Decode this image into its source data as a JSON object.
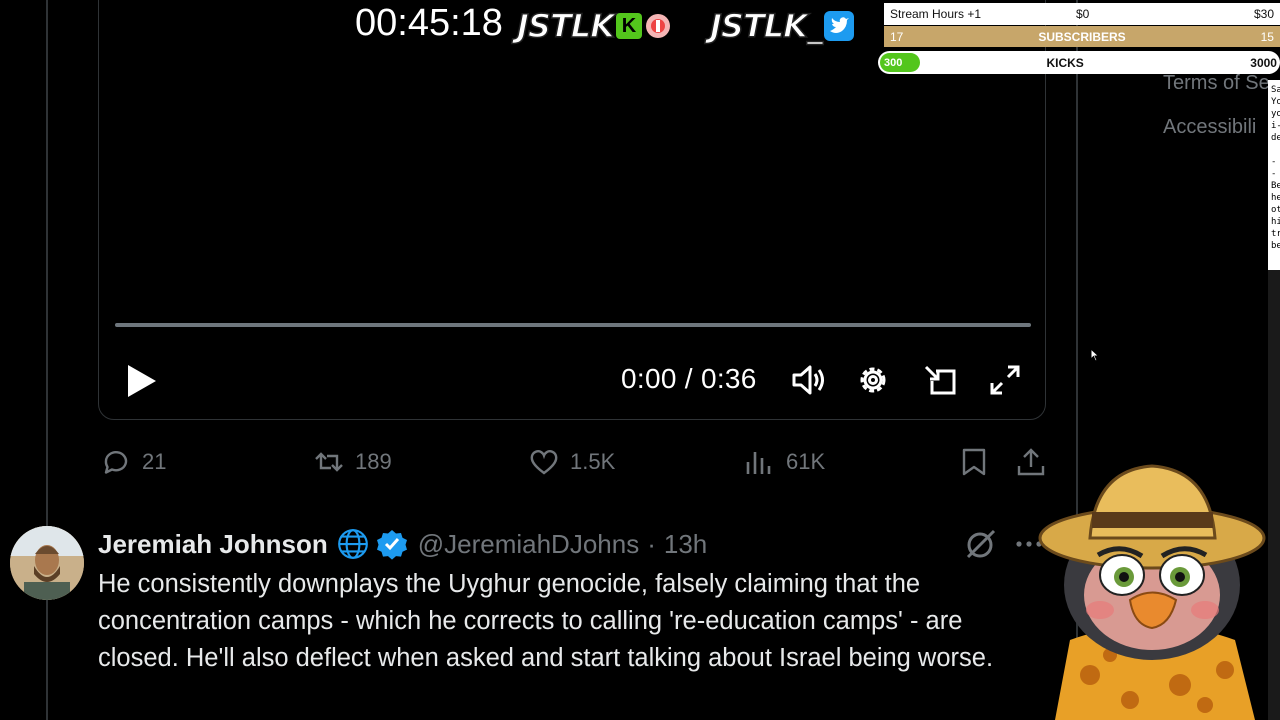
{
  "video": {
    "current_time": "0:00",
    "duration": "0:36",
    "progress": 0
  },
  "actions": {
    "replies": "21",
    "reposts": "189",
    "likes": "1.5K",
    "views": "61K"
  },
  "tweet": {
    "name": "Jeremiah Johnson",
    "handle": "@JeremiahDJohns",
    "time": "13h",
    "separator": "·",
    "text": "He consistently downplays the Uyghur genocide, falsely claiming that the concentration camps - which he corrects to calling 're-education camps' - are closed. He'll also deflect when asked and start talking about Israel being worse."
  },
  "sidebar_footer": {
    "terms": "Terms of Se",
    "accessibility": "Accessibili"
  },
  "notepad_lines": [
    "Sa",
    "Yo",
    "yo",
    "i-",
    "de",
    "",
    "--",
    "Be",
    "he",
    "ot",
    "hi",
    "tr",
    "be"
  ],
  "overlay": {
    "timer": "00:45:18",
    "logo1": "JSTLK",
    "logo2": "JSTLK",
    "logo2_suffix": "_",
    "kick_letter": "K",
    "goals": {
      "row1_label": "Stream Hours +1",
      "row1_mid": "$0",
      "row1_right": "$30",
      "row2_left": "17",
      "row2_label": "SUBSCRIBERS",
      "row2_right": "15",
      "row3_current": "300",
      "row3_label": "KICKS",
      "row3_right": "3000"
    }
  },
  "colors": {
    "background": "#000000",
    "verified": "#1d9bf0",
    "muted": "#71767b",
    "kick_green": "#53c61c",
    "subs_gold": "#c7a66a"
  }
}
